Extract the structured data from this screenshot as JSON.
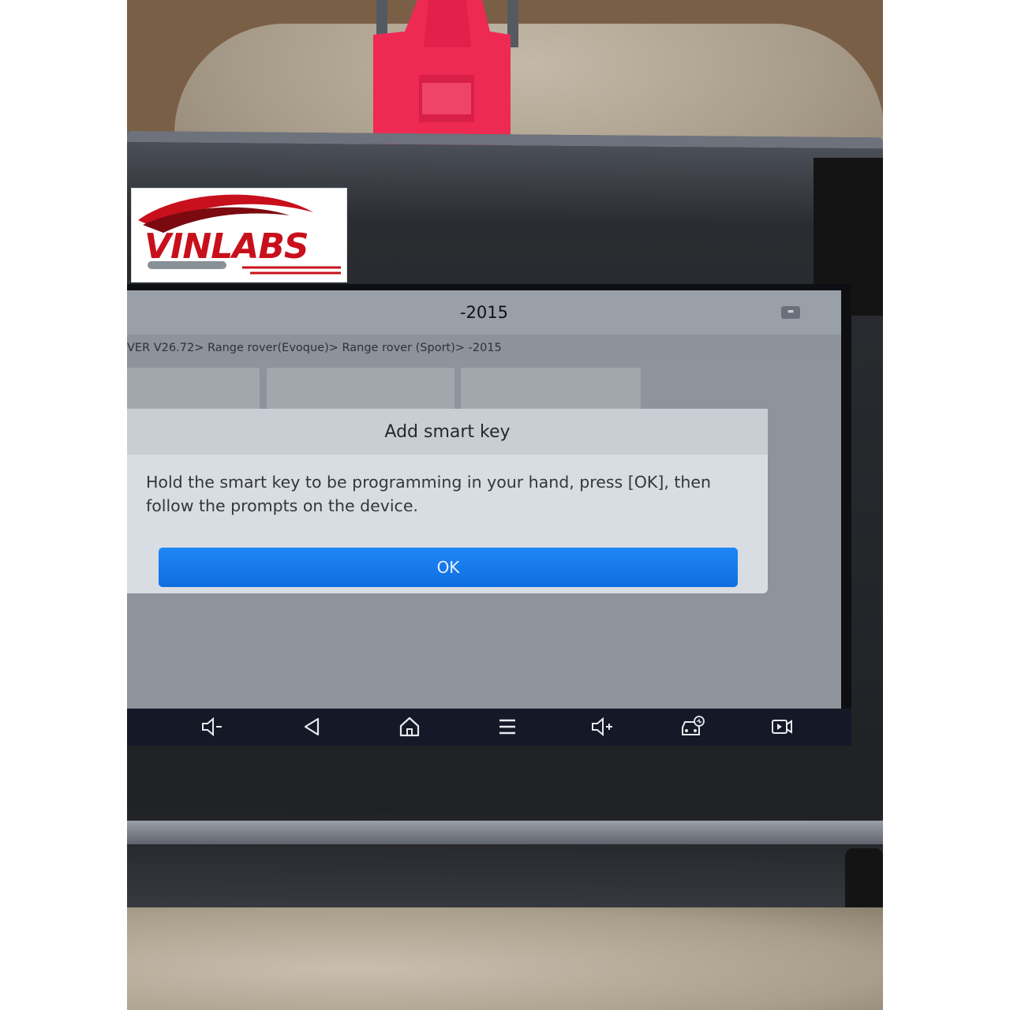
{
  "app": {
    "title": "-2015",
    "breadcrumb": "VER V26.72> Range rover(Evoque)> Range rover (Sport)> -2015",
    "message_icon": "message-icon"
  },
  "dialog": {
    "title": "Add smart key",
    "message_line1": "Hold the smart key to be programming in your hand, press [OK], then",
    "message_line2": "follow the prompts on the device.",
    "ok_label": "OK"
  },
  "navbar": {
    "buttons": [
      "volume-down-icon",
      "back-icon",
      "home-icon",
      "menu-icon",
      "volume-up-icon",
      "vehicle-diagnostics-icon",
      "screen-record-icon"
    ]
  },
  "watermark": {
    "brand": "VINLABS"
  },
  "colors": {
    "accent_blue": "#1679ea",
    "connector_red": "#ee2a52",
    "logo_red": "#c8101c"
  }
}
